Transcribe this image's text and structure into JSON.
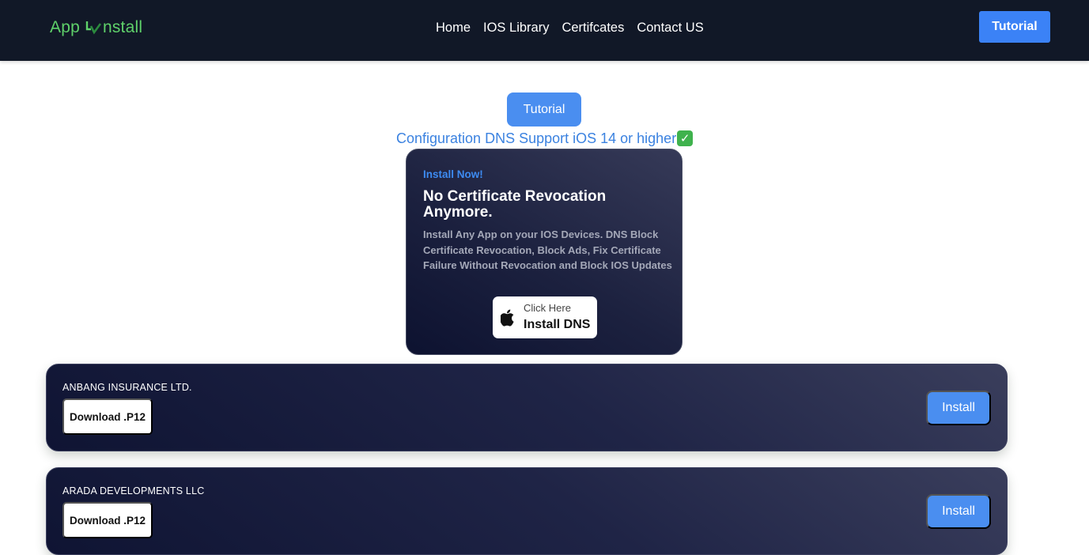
{
  "nav": {
    "logo_prefix": "App",
    "logo_suffix": "nstall",
    "links": [
      "Home",
      "IOS Library",
      "Certifcates",
      "Contact US"
    ],
    "cta": "Tutorial"
  },
  "hero": {
    "tutorial_label": "Tutorial",
    "config_text": "Configuration DNS Support iOS 14 or higher",
    "check_glyph": "✓",
    "card": {
      "eyebrow": "Install Now!",
      "title": "No Certificate Revocation Anymore.",
      "description": "Install Any App on your IOS Devices. DNS Block Certificate Revocation, Block Ads, Fix Certificate Failure Without Revocation and Block IOS Updates",
      "button_small": "Click Here",
      "button_big": "Install DNS",
      "button_icon": "apple-icon"
    }
  },
  "certificates": [
    {
      "name": "ANBANG INSURANCE LTD.",
      "download_label": "Download .P12",
      "install_label": "Install"
    },
    {
      "name": "ARADA DEVELOPMENTS LLC",
      "download_label": "Download .P12",
      "install_label": "Install"
    }
  ],
  "colors": {
    "navbar_bg": "#111827",
    "logo_green": "#5fd16a",
    "accent_blue": "#3b82f6",
    "card_dark": "#1c213f"
  }
}
